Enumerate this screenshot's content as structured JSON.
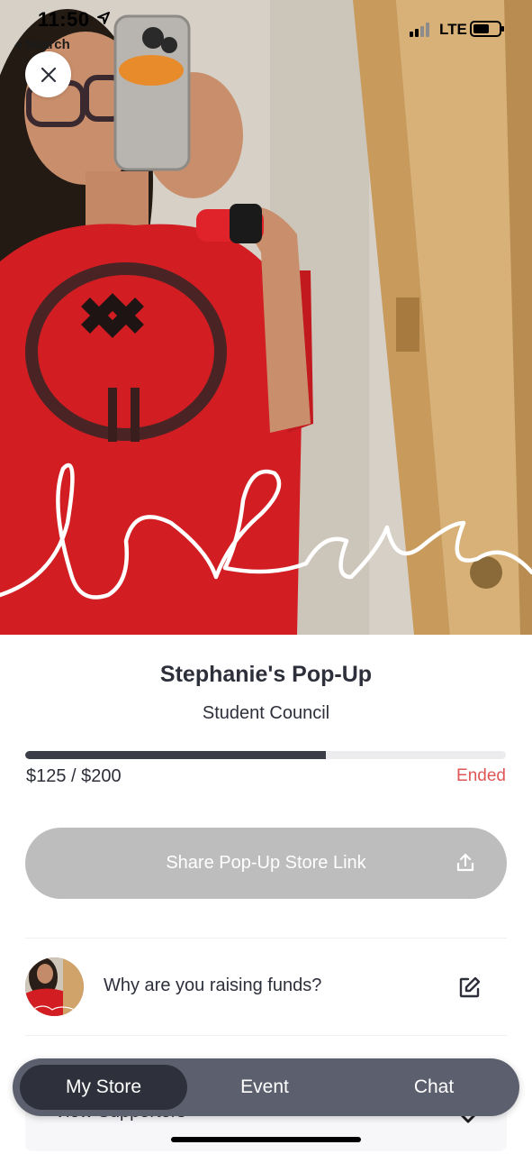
{
  "status_bar": {
    "time": "11:50",
    "back_label": "◂ Search",
    "carrier": "LTE"
  },
  "hero": {
    "photo_overlay_text": "I ♡ you"
  },
  "store": {
    "title": "Stephanie's Pop-Up",
    "organization": "Student Council",
    "raised": "$125",
    "goal": "$200",
    "amount_text": "$125 / $200",
    "progress_fraction": 0.625,
    "status": "Ended"
  },
  "share_button": {
    "label": "Share Pop-Up Store Link",
    "icon": "share-upload-icon"
  },
  "reason_row": {
    "text": "Why are you raising funds?",
    "icon": "edit-icon"
  },
  "supporters_row": {
    "text": "View Supporters",
    "icon": "chevron-down-icon"
  },
  "tabs": [
    {
      "label": "My Store",
      "active": true
    },
    {
      "label": "Event",
      "active": false
    },
    {
      "label": "Chat",
      "active": false
    }
  ],
  "colors": {
    "text_dark": "#2d2f3a",
    "status_ended": "#e05656",
    "share_disabled": "#bdbdbd",
    "tabbar": "#5c5f6d",
    "tab_active": "#2e303b"
  }
}
